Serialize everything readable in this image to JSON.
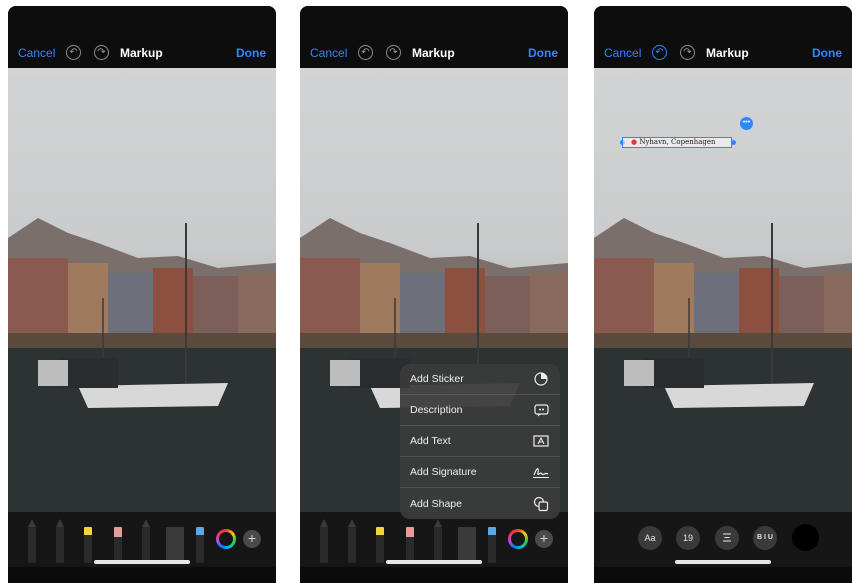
{
  "navbar": {
    "cancel_label": "Cancel",
    "title": "Markup",
    "done_label": "Done"
  },
  "menu": {
    "items": [
      {
        "label": "Add Sticker",
        "icon": "sticker-icon"
      },
      {
        "label": "Description",
        "icon": "description-icon"
      },
      {
        "label": "Add Text",
        "icon": "text-box-icon"
      },
      {
        "label": "Add Signature",
        "icon": "signature-icon"
      },
      {
        "label": "Add Shape",
        "icon": "shapes-icon"
      }
    ]
  },
  "text_annotation": {
    "text": "Nyhavn, Copenhagen"
  },
  "format_toolbar": {
    "font_label": "Aa",
    "size_value": "19",
    "style_label": "B I U"
  },
  "icons": {
    "undo": "undo-icon",
    "redo": "redo-icon",
    "add": "plus-icon",
    "color": "color-wheel-icon",
    "more": "ellipsis-icon"
  },
  "colors": {
    "accent": "#2f86ff",
    "toolbar": "#161616",
    "menu": "#3a3a3a",
    "text_color": "#000000"
  }
}
